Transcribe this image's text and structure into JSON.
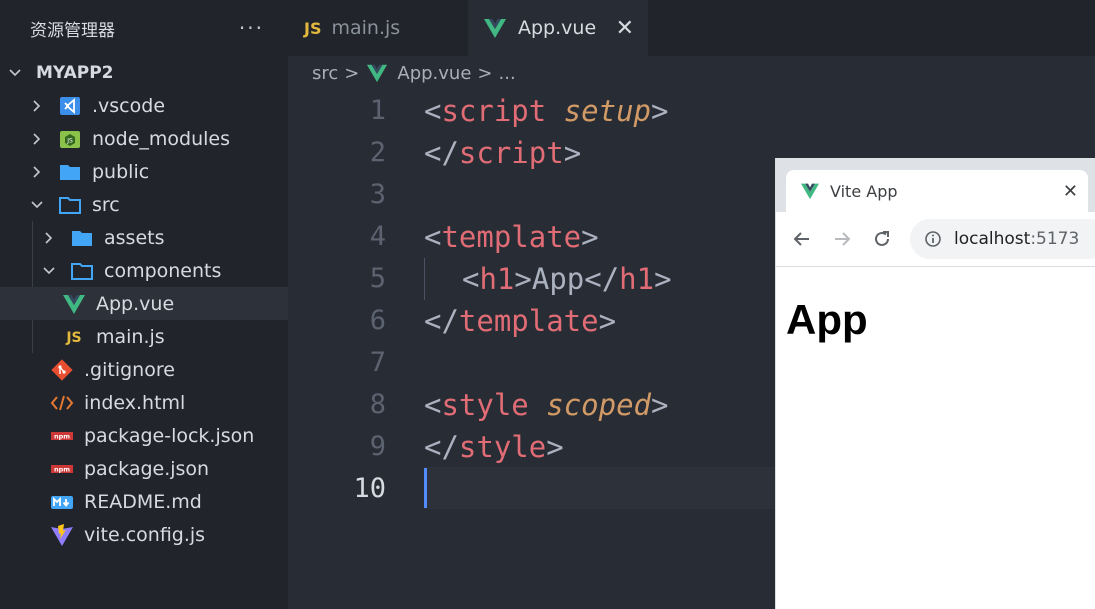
{
  "sidebar": {
    "title": "资源管理器",
    "more": "···",
    "root": "MYAPP2",
    "items": [
      {
        "label": ".vscode",
        "icon": "vscode-folder-icon"
      },
      {
        "label": "node_modules",
        "icon": "node-folder-icon"
      },
      {
        "label": "public",
        "icon": "folder-icon"
      },
      {
        "label": "src",
        "icon": "folder-open-icon"
      },
      {
        "label": "assets",
        "icon": "folder-icon"
      },
      {
        "label": "components",
        "icon": "folder-open-icon"
      },
      {
        "label": "App.vue",
        "icon": "vue-icon"
      },
      {
        "label": "main.js",
        "icon": "js-icon"
      },
      {
        "label": ".gitignore",
        "icon": "git-icon"
      },
      {
        "label": "index.html",
        "icon": "html-icon"
      },
      {
        "label": "package-lock.json",
        "icon": "npm-icon"
      },
      {
        "label": "package.json",
        "icon": "npm-icon"
      },
      {
        "label": "README.md",
        "icon": "markdown-icon"
      },
      {
        "label": "vite.config.js",
        "icon": "vite-icon"
      }
    ]
  },
  "tabs": [
    {
      "label": "main.js",
      "badge": "JS",
      "active": false
    },
    {
      "label": "App.vue",
      "close": "✕",
      "active": true
    }
  ],
  "breadcrumb": {
    "parts": [
      "src",
      "App.vue",
      "..."
    ],
    "separator": ">"
  },
  "editor": {
    "line_numbers": [
      "1",
      "2",
      "3",
      "4",
      "5",
      "6",
      "7",
      "8",
      "9",
      "10"
    ],
    "current_line": "10",
    "code": {
      "l1": {
        "open": "<",
        "tag": "script",
        "space": " ",
        "attr": "setup",
        "close": ">"
      },
      "l2": {
        "open": "</",
        "tag": "script",
        "close": ">"
      },
      "l4": {
        "open": "<",
        "tag": "template",
        "close": ">"
      },
      "l5": {
        "open1": "<",
        "tag1": "h1",
        "close1": ">",
        "text": "App",
        "open2": "</",
        "tag2": "h1",
        "close2": ">"
      },
      "l6": {
        "open": "</",
        "tag": "template",
        "close": ">"
      },
      "l8": {
        "open": "<",
        "tag": "style",
        "space": " ",
        "attr": "scoped",
        "close": ">"
      },
      "l9": {
        "open": "</",
        "tag": "style",
        "close": ">"
      }
    }
  },
  "browser": {
    "tab_title": "Vite App",
    "tab_close": "✕",
    "url_host": "localhost",
    "url_port": ":5173",
    "heading": "App"
  },
  "colors": {
    "vue_green": "#41b883",
    "vue_dark": "#35495e",
    "js_yellow": "#e2b93d",
    "folder_blue": "#42a5f5"
  }
}
